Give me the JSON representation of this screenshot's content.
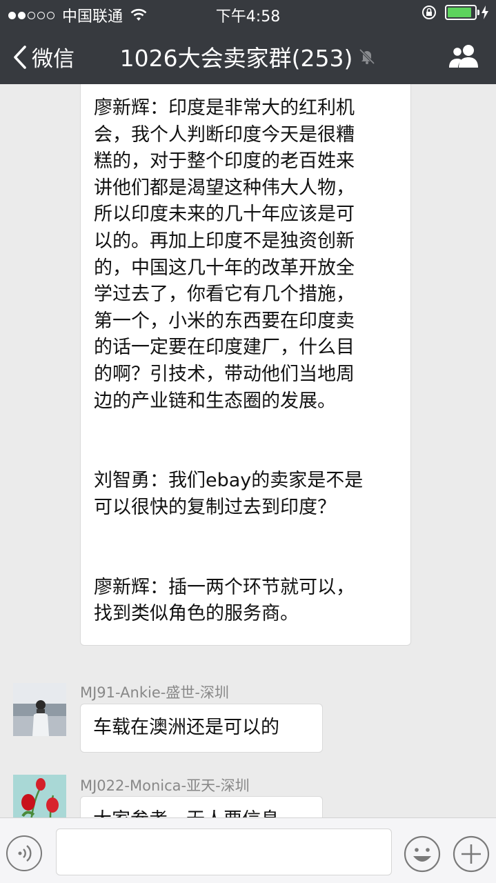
{
  "status_bar": {
    "carrier": "中国联通",
    "time": "下午4:58",
    "signal_dots_filled": 2,
    "signal_dots_total": 5,
    "battery_level": 0.9
  },
  "nav": {
    "back_label": "微信",
    "title": "1026大会卖家群(253)",
    "icons": [
      "back-chevron-icon",
      "mute-bell-icon",
      "group-members-icon"
    ]
  },
  "messages": [
    {
      "text": "廖新辉：印度是非常大的红利机\n会，我个人判断印度今天是很糟\n糕的，对于整个印度的老百姓来\n讲他们都是渴望这种伟大人物，\n所以印度未来的几十年应该是可\n以的。再加上印度不是独资创新\n的，中国这几十年的改革开放全\n学过去了，你看它有几个措施，\n第一个，小米的东西要在印度卖\n的话一定要在印度建厂，什么目\n的啊？引技术，带动他们当地周\n边的产业链和生态圈的发展。\n\n\n刘智勇：我们ebay的卖家是不是\n可以很快的复制过去到印度？\n\n\n廖新辉：插一两个环节就可以，\n找到类似角色的服务商。"
    },
    {
      "sender": "MJ91-Ankie-盛世-深圳",
      "text": "车载在澳洲还是可以的"
    },
    {
      "sender": "MJ022-Monica-亚天-深圳",
      "text": "大家参考，无人要信息"
    }
  ],
  "input_bar": {
    "icons": [
      "voice-icon",
      "emoji-icon",
      "plus-icon"
    ]
  },
  "colors": {
    "header_bg": "#373a3f",
    "chat_bg": "#ebebeb",
    "battery_fill": "#5dd35d"
  }
}
